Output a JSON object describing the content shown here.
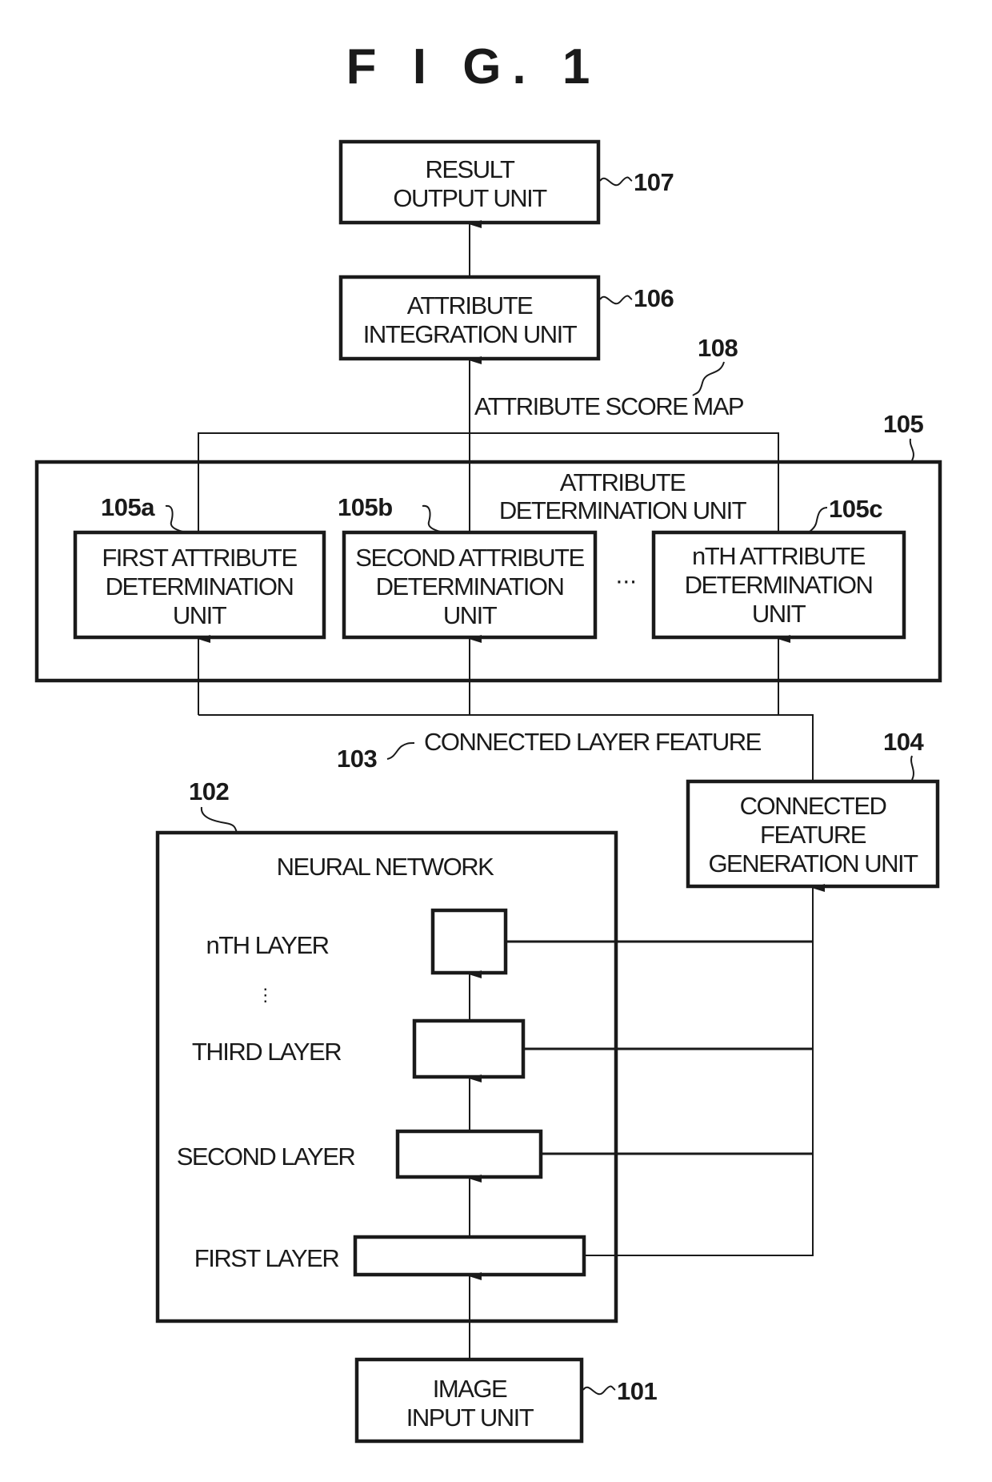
{
  "figure": {
    "title": "F I G. 1"
  },
  "units": {
    "result_output": {
      "ref": "107",
      "lines": [
        "RESULT",
        "OUTPUT UNIT"
      ]
    },
    "attribute_integration": {
      "ref": "106",
      "lines": [
        "ATTRIBUTE",
        "INTEGRATION UNIT"
      ]
    },
    "attribute_score_map": {
      "ref": "108",
      "label": "ATTRIBUTE SCORE MAP"
    },
    "attribute_determination": {
      "ref": "105",
      "lines": [
        "ATTRIBUTE",
        "DETERMINATION UNIT"
      ],
      "ellipsis": "···",
      "subunits": [
        {
          "ref": "105a",
          "lines": [
            "FIRST ATTRIBUTE",
            "DETERMINATION",
            "UNIT"
          ]
        },
        {
          "ref": "105b",
          "lines": [
            "SECOND ATTRIBUTE",
            "DETERMINATION",
            "UNIT"
          ]
        },
        {
          "ref": "105c",
          "lines": [
            "nTH ATTRIBUTE",
            "DETERMINATION",
            "UNIT"
          ]
        }
      ]
    },
    "connected_layer_feature": {
      "ref": "103",
      "label": "CONNECTED LAYER FEATURE"
    },
    "connected_feature_generation": {
      "ref": "104",
      "lines": [
        "CONNECTED",
        "FEATURE",
        "GENERATION UNIT"
      ]
    },
    "neural_network": {
      "ref": "102",
      "title": "NEURAL NETWORK",
      "vertical_ellipsis": "⋮",
      "layers": [
        {
          "label": "nTH LAYER"
        },
        {
          "label": "THIRD LAYER"
        },
        {
          "label": "SECOND LAYER"
        },
        {
          "label": "FIRST LAYER"
        }
      ]
    },
    "image_input": {
      "ref": "101",
      "lines": [
        "IMAGE",
        "INPUT UNIT"
      ]
    }
  }
}
